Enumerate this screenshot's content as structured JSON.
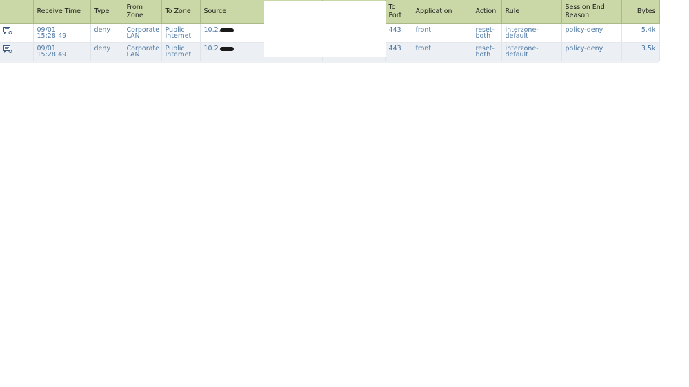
{
  "columns": [
    {
      "key": "icon",
      "label": ""
    },
    {
      "key": "blank",
      "label": ""
    },
    {
      "key": "receive_time",
      "label": "Receive Time"
    },
    {
      "key": "type",
      "label": "Type"
    },
    {
      "key": "from_zone",
      "label": "From Zone"
    },
    {
      "key": "to_zone",
      "label": "To Zone"
    },
    {
      "key": "source",
      "label": "Source"
    },
    {
      "key": "redacted_1",
      "label": ""
    },
    {
      "key": "redacted_2",
      "label": ""
    },
    {
      "key": "to_port",
      "label": "To Port"
    },
    {
      "key": "application",
      "label": "Application"
    },
    {
      "key": "action",
      "label": "Action"
    },
    {
      "key": "rule",
      "label": "Rule"
    },
    {
      "key": "session_end_reason",
      "label": "Session End Reason"
    },
    {
      "key": "bytes",
      "label": "Bytes"
    }
  ],
  "rows": [
    {
      "receive_time": "09/01 15:28:49",
      "type": "deny",
      "from_zone": "Corporate LAN",
      "to_zone": "Public Internet",
      "source": "10.2.",
      "to_port": "443",
      "application": "front",
      "action": "reset-both",
      "rule": "interzone-default",
      "session_end_reason": "policy-deny",
      "bytes": "5.4k"
    },
    {
      "receive_time": "09/01 15:28:49",
      "type": "deny",
      "from_zone": "Corporate LAN",
      "to_zone": "Public Internet",
      "source": "10.2.",
      "to_port": "443",
      "application": "front",
      "action": "reset-both",
      "rule": "interzone-default",
      "session_end_reason": "policy-deny",
      "bytes": "3.5k"
    }
  ],
  "icons": {
    "detail": "log-detail-icon"
  },
  "colors": {
    "header_bg": "#cad7a6",
    "link_text": "#4f78a3",
    "alt_row": "#ecf0f4"
  }
}
